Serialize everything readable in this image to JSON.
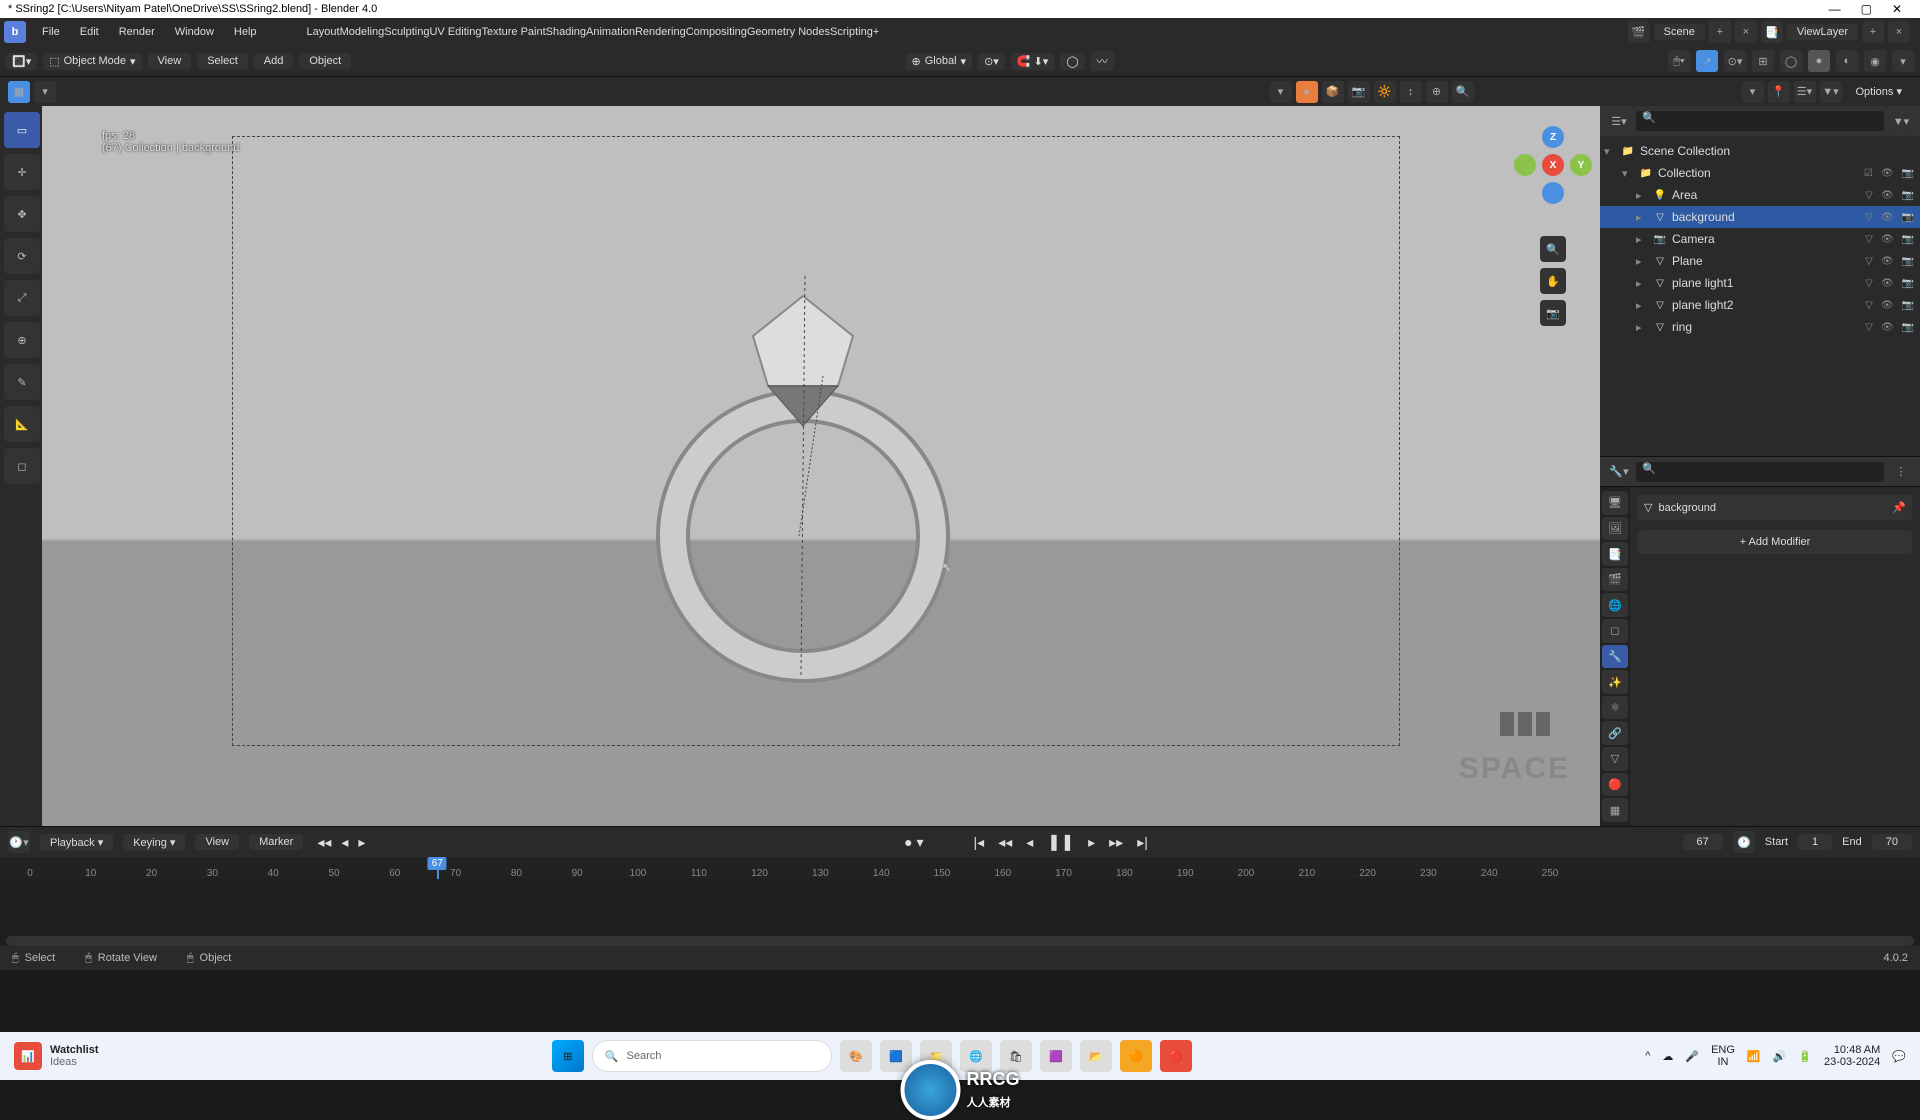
{
  "title": "* SSring2 [C:\\Users\\Nityam Patel\\OneDrive\\SS\\SSring2.blend] - Blender 4.0",
  "menus": [
    "File",
    "Edit",
    "Render",
    "Window",
    "Help"
  ],
  "tabs": [
    "Layout",
    "Modeling",
    "Sculpting",
    "UV Editing",
    "Texture Paint",
    "Shading",
    "Animation",
    "Rendering",
    "Compositing",
    "Geometry Nodes",
    "Scripting"
  ],
  "active_tab": "Layout",
  "scene_label": "Scene",
  "viewlayer_label": "ViewLayer",
  "mode": "Object Mode",
  "viewmenus": [
    "View",
    "Select",
    "Add",
    "Object"
  ],
  "orientation": "Global",
  "options_label": "Options",
  "viewport_info": {
    "fps": "fps: 28",
    "collection": "(67) Collection | background"
  },
  "space_text": "SPACE",
  "outliner": {
    "root": "Scene Collection",
    "collection": "Collection",
    "items": [
      {
        "name": "Area",
        "icon": "light"
      },
      {
        "name": "background",
        "icon": "mesh",
        "sel": true
      },
      {
        "name": "Camera",
        "icon": "camera"
      },
      {
        "name": "Plane",
        "icon": "mesh"
      },
      {
        "name": "plane light1",
        "icon": "mesh"
      },
      {
        "name": "plane light2",
        "icon": "mesh"
      },
      {
        "name": "ring",
        "icon": "mesh"
      }
    ]
  },
  "properties": {
    "crumb": "background",
    "add_modifier": "Add Modifier"
  },
  "timeline": {
    "menus": [
      "Playback",
      "Keying",
      "View",
      "Marker"
    ],
    "current": 67,
    "start_label": "Start",
    "start": 1,
    "end_label": "End",
    "end": 70,
    "ticks": [
      0,
      10,
      20,
      30,
      40,
      50,
      60,
      70,
      80,
      90,
      100,
      110,
      120,
      130,
      140,
      150,
      160,
      170,
      180,
      190,
      200,
      210,
      220,
      230,
      240,
      250
    ]
  },
  "status": {
    "select": "Select",
    "rotate": "Rotate View",
    "object": "Object",
    "version": "4.0.2"
  },
  "taskbar": {
    "weather_title": "Watchlist",
    "weather_sub": "Ideas",
    "search_placeholder": "Search",
    "lang": "ENG",
    "lang2": "IN",
    "time": "10:48 AM",
    "date": "23-03-2024"
  }
}
